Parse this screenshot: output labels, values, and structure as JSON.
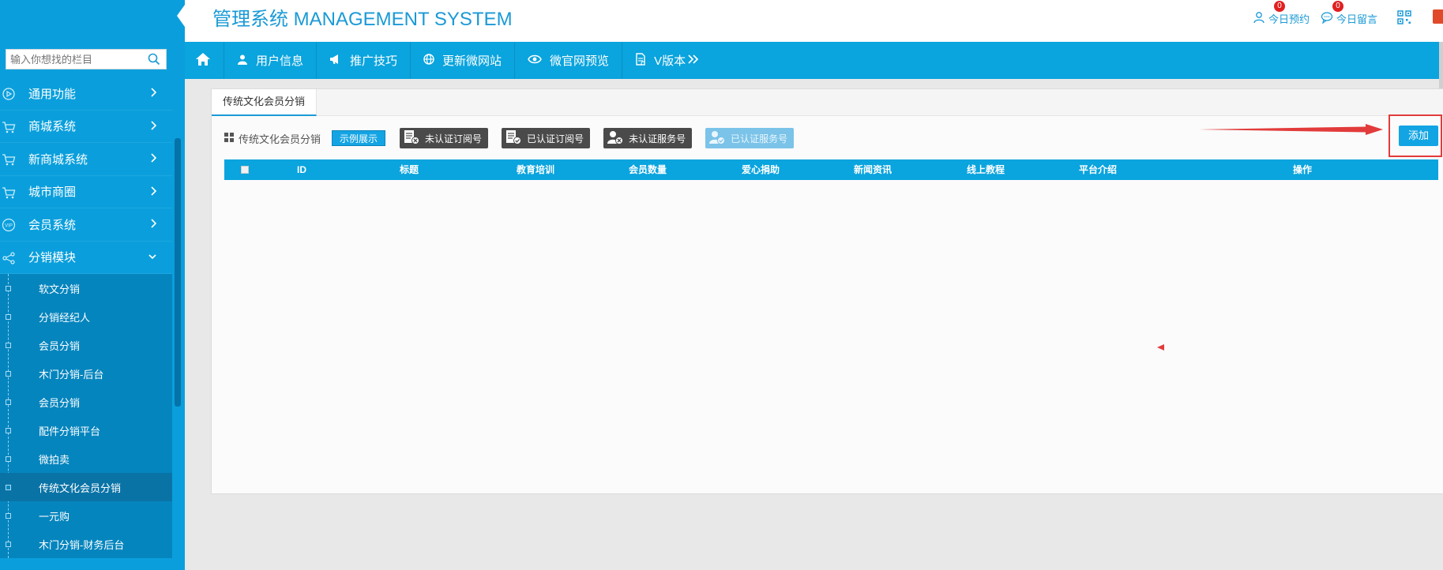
{
  "header": {
    "title": "管理系统 MANAGEMENT SYSTEM",
    "links": [
      {
        "label": "今日预约",
        "count": "0",
        "icon": "user-icon"
      },
      {
        "label": "今日留言",
        "count": "0",
        "icon": "chat-icon"
      }
    ],
    "qr_icon": "qr-code-icon"
  },
  "sidebar": {
    "search_placeholder": "输入你想找的栏目",
    "items": [
      {
        "label": "通用功能",
        "icon": "play-circle-icon"
      },
      {
        "label": "商城系统",
        "icon": "cart-icon"
      },
      {
        "label": "新商城系统",
        "icon": "cart-icon"
      },
      {
        "label": "城市商圈",
        "icon": "cart-icon"
      },
      {
        "label": "会员系统",
        "icon": "vip-icon"
      },
      {
        "label": "分销模块",
        "icon": "share-icon",
        "expanded": true
      }
    ],
    "sub_items": [
      {
        "label": "软文分销"
      },
      {
        "label": "分销经纪人"
      },
      {
        "label": "会员分销"
      },
      {
        "label": "木门分销-后台"
      },
      {
        "label": "会员分销"
      },
      {
        "label": "配件分销平台"
      },
      {
        "label": "微拍卖"
      },
      {
        "label": "传统文化会员分销",
        "active": true
      },
      {
        "label": "一元购"
      },
      {
        "label": "木门分销-财务后台"
      }
    ]
  },
  "nav": {
    "items": [
      {
        "label": "",
        "icon": "home-icon"
      },
      {
        "label": "用户信息",
        "icon": "user-icon"
      },
      {
        "label": "推广技巧",
        "icon": "megaphone-icon"
      },
      {
        "label": "更新微网站",
        "icon": "globe-icon"
      },
      {
        "label": "微官网预览",
        "icon": "eye-icon"
      },
      {
        "label": "V版本",
        "icon": "document-icon"
      }
    ]
  },
  "main": {
    "tab_label": "传统文化会员分销",
    "toolbar": {
      "title": "传统文化会员分销",
      "demo_label": "示例展示",
      "account_buttons": [
        {
          "label": "未认证订阅号",
          "icon": "doc-x-icon"
        },
        {
          "label": "已认证订阅号",
          "icon": "doc-check-icon"
        },
        {
          "label": "未认证服务号",
          "icon": "person-x-icon"
        },
        {
          "label": "已认证服务号",
          "icon": "person-check-icon"
        }
      ]
    },
    "add_label": "添加",
    "table": {
      "columns": [
        "ID",
        "标题",
        "教育培训",
        "会员数量",
        "爱心捐助",
        "新闻资讯",
        "线上教程",
        "平台介绍",
        "操作"
      ]
    }
  },
  "colors": {
    "primary": "#0aa4de",
    "sidebar": "#0a9fdc",
    "submenu": "#0585be",
    "highlight_red": "#e23b3b"
  }
}
